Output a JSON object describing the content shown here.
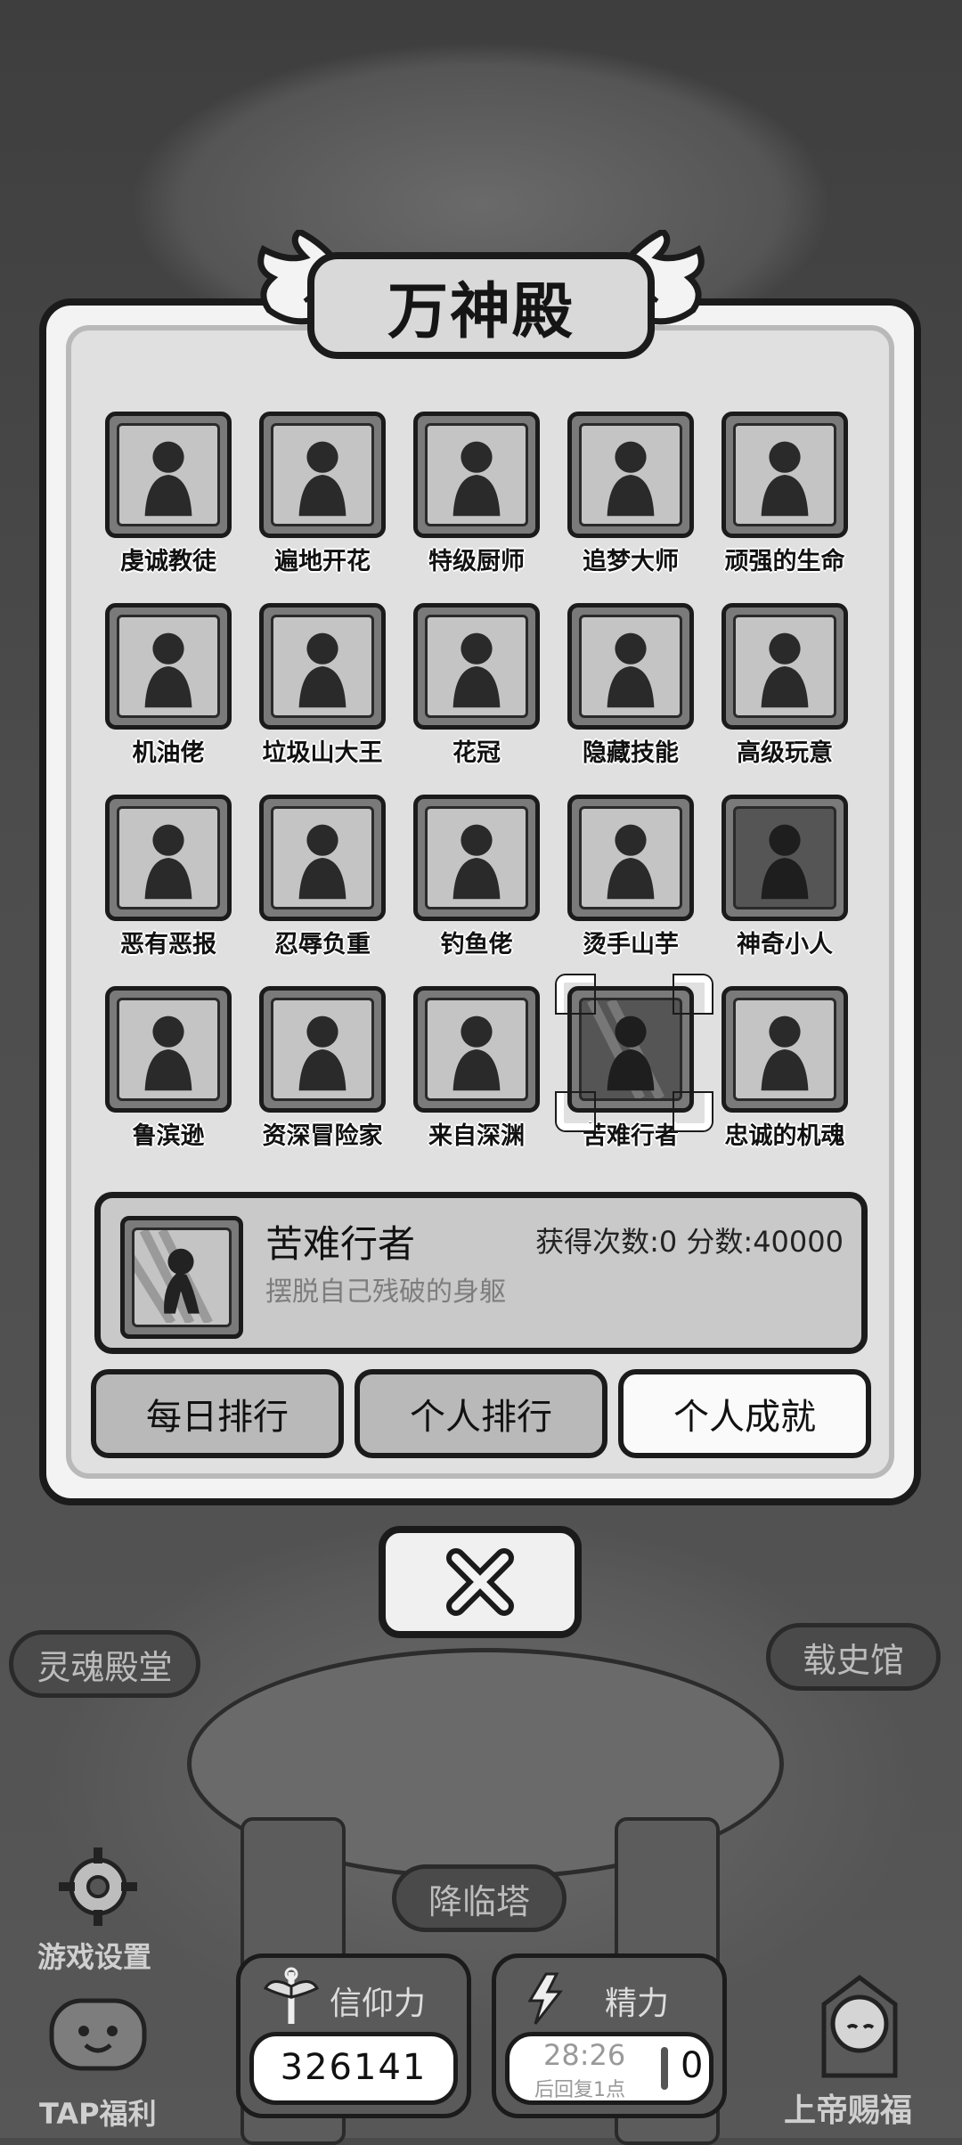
{
  "dialog": {
    "title": "万神殿",
    "achievements": [
      {
        "label": "虔诚教徒",
        "icon": "praying-woman-icon"
      },
      {
        "label": "遍地开花",
        "icon": "burger-shop-icon"
      },
      {
        "label": "特级厨师",
        "icon": "chef-icon"
      },
      {
        "label": "追梦大师",
        "icon": "stage-building-icon"
      },
      {
        "label": "顽强的生命",
        "icon": "haloed-figure-icon"
      },
      {
        "label": "机油佬",
        "icon": "robot-dome-icon"
      },
      {
        "label": "垃圾山大王",
        "icon": "trash-mountain-king-icon"
      },
      {
        "label": "花冠",
        "icon": "flower-crown-icon"
      },
      {
        "label": "隐藏技能",
        "icon": "singing-figure-icon"
      },
      {
        "label": "高级玩意",
        "icon": "robot-tshirt-icon"
      },
      {
        "label": "恶有恶报",
        "icon": "boomerang-icon"
      },
      {
        "label": "忍辱负重",
        "icon": "kneeling-figure-icon"
      },
      {
        "label": "钓鱼佬",
        "icon": "fish-icon"
      },
      {
        "label": "烫手山芋",
        "icon": "hands-holding-gem-icon"
      },
      {
        "label": "神奇小人",
        "icon": "dancing-figure-icon"
      },
      {
        "label": "鲁滨逊",
        "icon": "island-palm-icon"
      },
      {
        "label": "资深冒险家",
        "icon": "cave-explorer-icon"
      },
      {
        "label": "来自深渊",
        "icon": "glowing-head-icon"
      },
      {
        "label": "苦难行者",
        "icon": "suffering-walker-icon"
      },
      {
        "label": "忠诚的机魂",
        "icon": "fairy-icon"
      }
    ],
    "selected_index": 18,
    "detail": {
      "name": "苦难行者",
      "stats": "获得次数:0  分数:40000",
      "description": "摆脱自己残破的身躯"
    },
    "tabs": [
      "每日排行",
      "个人排行",
      "个人成就"
    ],
    "active_tab": 2
  },
  "scene": {
    "soul_hall": "灵魂殿堂",
    "history_hall": "载史馆",
    "descend_tower": "降临塔",
    "game_settings": "游戏设置",
    "tap_welfare": "TAP福利",
    "god_blessing": "上帝赐福"
  },
  "hud": {
    "faith_label": "信仰力",
    "faith_value": "326141",
    "energy_label": "精力",
    "energy_timer": "28:26",
    "energy_sub": "后回复1点",
    "energy_value": "0"
  }
}
